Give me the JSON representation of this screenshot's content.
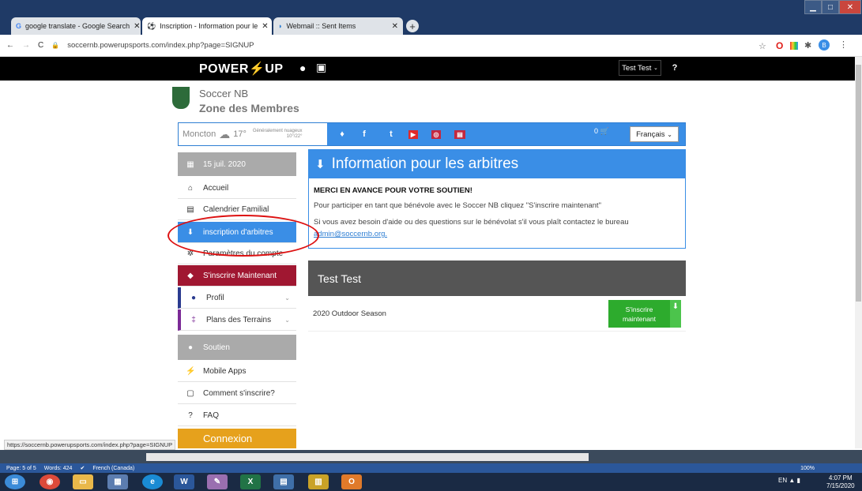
{
  "browser": {
    "tabs": [
      {
        "label": "google translate - Google Search",
        "icon": "google-icon"
      },
      {
        "label": "Inscription - Information pour le",
        "icon": "soccer-ball-icon"
      },
      {
        "label": "Webmail :: Sent Items",
        "icon": "webmail-icon"
      }
    ],
    "new_tab": "+",
    "url": "soccernb.powerupsports.com/index.php?page=SIGNUP",
    "profile_initial": "B"
  },
  "site": {
    "brand_left": "POWER",
    "brand_bolt": "⚡",
    "brand_right": "UP",
    "user_label": "Test Test",
    "help_label": "?"
  },
  "club": {
    "name": "Soccer NB",
    "subtitle": "Zone des Membres"
  },
  "toolbar": {
    "city": "Moncton",
    "temp": "17°",
    "weather_desc": "Généralement nuageux",
    "weather_range": "10°/22°",
    "social": [
      "♦",
      "f",
      "t",
      "▶",
      "◎",
      "▤"
    ],
    "cart": "0",
    "language": "Français"
  },
  "sidebar": {
    "date": "15 juil. 2020",
    "items": [
      {
        "label": "Accueil",
        "icon": "home-icon"
      },
      {
        "label": "Calendrier Familial",
        "icon": "calendar-icon"
      },
      {
        "label": "inscription d'arbitres",
        "icon": "download-icon"
      },
      {
        "label": "Paramètres du compte",
        "icon": "gear-icon"
      },
      {
        "label": "S'inscrire Maintenant",
        "icon": "tag-icon"
      },
      {
        "label": "Profil",
        "icon": "user-icon"
      },
      {
        "label": "Plans des Terrains",
        "icon": "map-pin-icon"
      }
    ],
    "soutien": "Soutien",
    "soutien_items": [
      {
        "label": "Mobile Apps",
        "icon": "bolt-icon"
      },
      {
        "label": "Comment s'inscrire?",
        "icon": "document-icon"
      },
      {
        "label": "FAQ",
        "icon": "question-icon"
      }
    ],
    "connexion": "Connexion"
  },
  "info": {
    "title": "Information pour les arbitres",
    "bold": "MERCI EN AVANCE POUR VOTRE SOUTIEN!",
    "p1": "Pour participer en tant que bénévole avec le Soccer NB cliquez \"S'inscrire maintenant\"",
    "p2": "Si vous avez besoin d'aide ou des questions sur le bénévolat s'il vous plaît contactez le bureau",
    "email": "admin@soccernb.org."
  },
  "registration": {
    "user": "Test Test",
    "season": "2020 Outdoor Season",
    "button": "S'inscrire maintenant"
  },
  "status_link": "https://soccernb.powerupsports.com/index.php?page=SIGNUP",
  "word_status": {
    "page": "Page: 5 of 5",
    "words": "Words: 424",
    "language": "French (Canada)",
    "zoom": "100%"
  },
  "taskbar": {
    "lang": "EN",
    "time": "4:07 PM",
    "date": "7/15/2020"
  }
}
